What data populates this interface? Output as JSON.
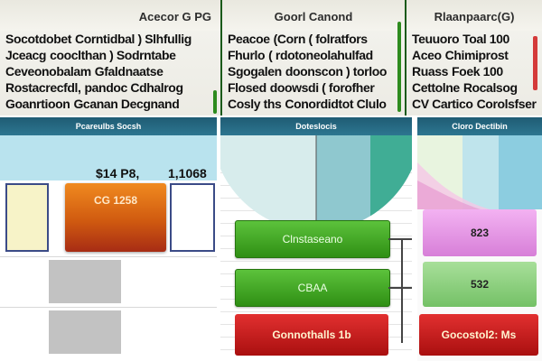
{
  "panels": [
    {
      "header": "Acecor G PG",
      "rows": [
        {
          "c1": "Socotdobet",
          "c2": "Corntidbal ) Slhfullig"
        },
        {
          "c1": "Jceacg",
          "c2": "cooclthan ) Sodrntabe"
        },
        {
          "c1": "Ceveonobalam",
          "c2": "Gfaldnaatse"
        },
        {
          "c1": "Rostacrecfdl,",
          "c2": "pandoc Cdhalrog"
        },
        {
          "c1": "Goanrtioon",
          "c2": "Gcanan Decgnand"
        }
      ]
    },
    {
      "header": "Goorl Canond",
      "rows": [
        {
          "c1": "Peacoe",
          "c2": "(Corn ( folratfors"
        },
        {
          "c1": "Fhurlo",
          "c2": "( rdotoneolahulfad"
        },
        {
          "c1": "Sgogalen",
          "c2": "doonscon ) torloo"
        },
        {
          "c1": "Flosed",
          "c2": "doowsdi ( forofher"
        },
        {
          "c1": "Cosly ths",
          "c2": "Conordidtot Clulo"
        }
      ]
    },
    {
      "header": "Rlaanpaarc(G)",
      "rows": [
        {
          "c1": "Teuuoro",
          "c2": "Toal 100"
        },
        {
          "c1": "Aceo",
          "c2": "Chimiprost"
        },
        {
          "c1": "Ruass",
          "c2": "Foek 100"
        },
        {
          "c1": "Cettolne",
          "c2": "Rocalsog"
        },
        {
          "c1": "CV Cartico",
          "c2": "Corolsfser"
        }
      ]
    }
  ],
  "sections": [
    "Pcareulbs Socsh",
    "Doteslocis",
    "Cloro Dectibin"
  ],
  "left": {
    "value1": "$14 P8,",
    "value2": "1,1068",
    "orange_label": "CG 1258"
  },
  "middle": {
    "btn1": "Clnstaseano",
    "btn2": "CBAA",
    "btn3": "Gonnothalls 1b"
  },
  "right": {
    "pink_value": "823",
    "green_value": "532",
    "red_label": "Gocostol2: Ms"
  }
}
